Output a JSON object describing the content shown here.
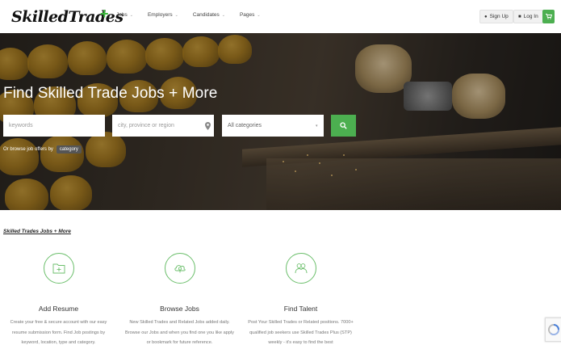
{
  "brand": {
    "name": "SkilledTrades",
    "plus": "+",
    "accent": "#4caf50"
  },
  "nav": {
    "items": [
      {
        "label": "Jobs"
      },
      {
        "label": "Employers"
      },
      {
        "label": "Candidates"
      },
      {
        "label": "Pages"
      }
    ],
    "sign_up": "Sign Up",
    "log_in": "Log In"
  },
  "hero": {
    "title": "Find Skilled Trade Jobs + More",
    "keywords_placeholder": "keywords",
    "location_placeholder": "city, province or region",
    "category_selected": "All categories",
    "browse_text": "Or browse job offers by",
    "category_button": "category"
  },
  "content": {
    "section_link": "Skilled Trades Jobs + More",
    "features": [
      {
        "title": "Add Resume",
        "icon": "folder-plus-icon",
        "desc": "Create your free & secure account with our easy resume submission form. Find Job postings by keyword, location, type and category."
      },
      {
        "title": "Browse Jobs",
        "icon": "cloud-lightbulb-icon",
        "desc": "New Skilled Trades and Related Jobs added daily. Browse our Jobs and when you find one you like apply or bookmark for future reference."
      },
      {
        "title": "Find Talent",
        "icon": "people-icon",
        "desc": "Post Your Skilled Trades or Related positions. 7000+ qualified job seekers use Skilled Trades Plus (STP) weekly - it's easy to find the best"
      }
    ]
  }
}
